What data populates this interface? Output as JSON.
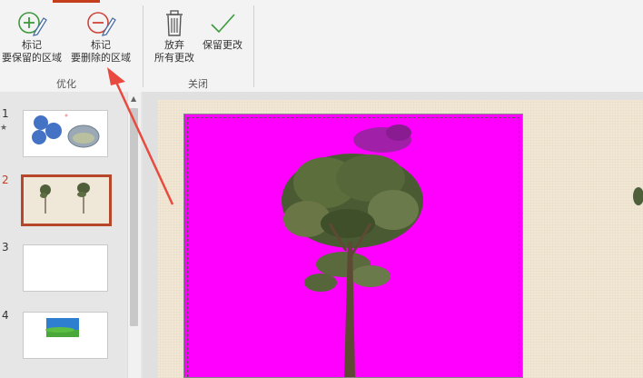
{
  "ribbon": {
    "buttons": {
      "mark_keep": {
        "line1": "标记",
        "line2": "要保留的区域"
      },
      "mark_remove": {
        "line1": "标记",
        "line2": "要删除的区域"
      },
      "discard": {
        "line1": "放弃",
        "line2": "所有更改"
      },
      "keep_changes": {
        "line1": "保留更改"
      }
    },
    "groups": {
      "refine": "优化",
      "close": "关闭"
    }
  },
  "slides": [
    {
      "number": "1",
      "marker": "★"
    },
    {
      "number": "2"
    },
    {
      "number": "3"
    },
    {
      "number": "4"
    }
  ],
  "colors": {
    "accent": "#c43e1c",
    "selection": "#b7472a",
    "removal_area": "#ff00ff",
    "annotation_arrow": "#e84a3f"
  }
}
